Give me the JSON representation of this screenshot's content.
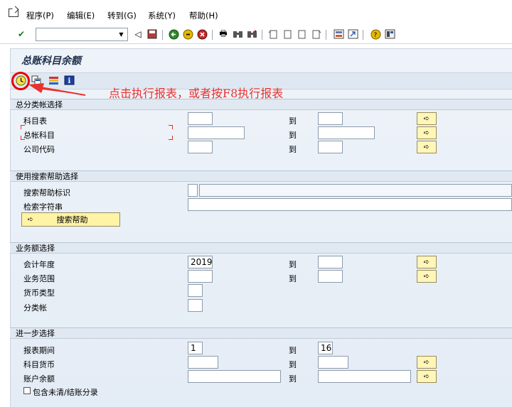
{
  "menu": {
    "items": [
      "程序(P)",
      "编辑(E)",
      "转到(G)",
      "系统(Y)",
      "帮助(H)"
    ]
  },
  "toolbar": {
    "okcode_value": ""
  },
  "screen": {
    "title": "总账科目余额"
  },
  "annotation": {
    "text": "点击执行报表，或者按F8执行报表",
    "color": "#e8322f"
  },
  "groups": {
    "gl_selection": {
      "header": "总分类帐选择",
      "rows": [
        {
          "label": "科目表",
          "from": "",
          "to_label": "到",
          "to": ""
        },
        {
          "label": "总帐科目",
          "from": "",
          "to_label": "到",
          "to": ""
        },
        {
          "label": "公司代码",
          "from": "",
          "to_label": "到",
          "to": ""
        }
      ]
    },
    "search_help": {
      "header": "使用搜索帮助选择",
      "label_id": "搜索帮助标识",
      "label_string": "检索字符串",
      "button": "搜索帮助"
    },
    "amount_selection": {
      "header": "业务额选择",
      "rows": [
        {
          "label": "会计年度",
          "from": "2019",
          "to_label": "到",
          "to": ""
        },
        {
          "label": "业务范围",
          "from": "",
          "to_label": "到",
          "to": ""
        },
        {
          "label": "货币类型",
          "from": ""
        },
        {
          "label": "分类帐",
          "from": ""
        }
      ]
    },
    "further": {
      "header": "进一步选择",
      "rows": [
        {
          "label": "报表期间",
          "from": "1",
          "to_label": "到",
          "to": "16"
        },
        {
          "label": "科目货币",
          "from": "",
          "to_label": "到",
          "to": ""
        },
        {
          "label": "账户余额",
          "from": "",
          "to_label": "到",
          "to": ""
        }
      ],
      "checkbox_label": "包含未清/结账分录"
    }
  }
}
